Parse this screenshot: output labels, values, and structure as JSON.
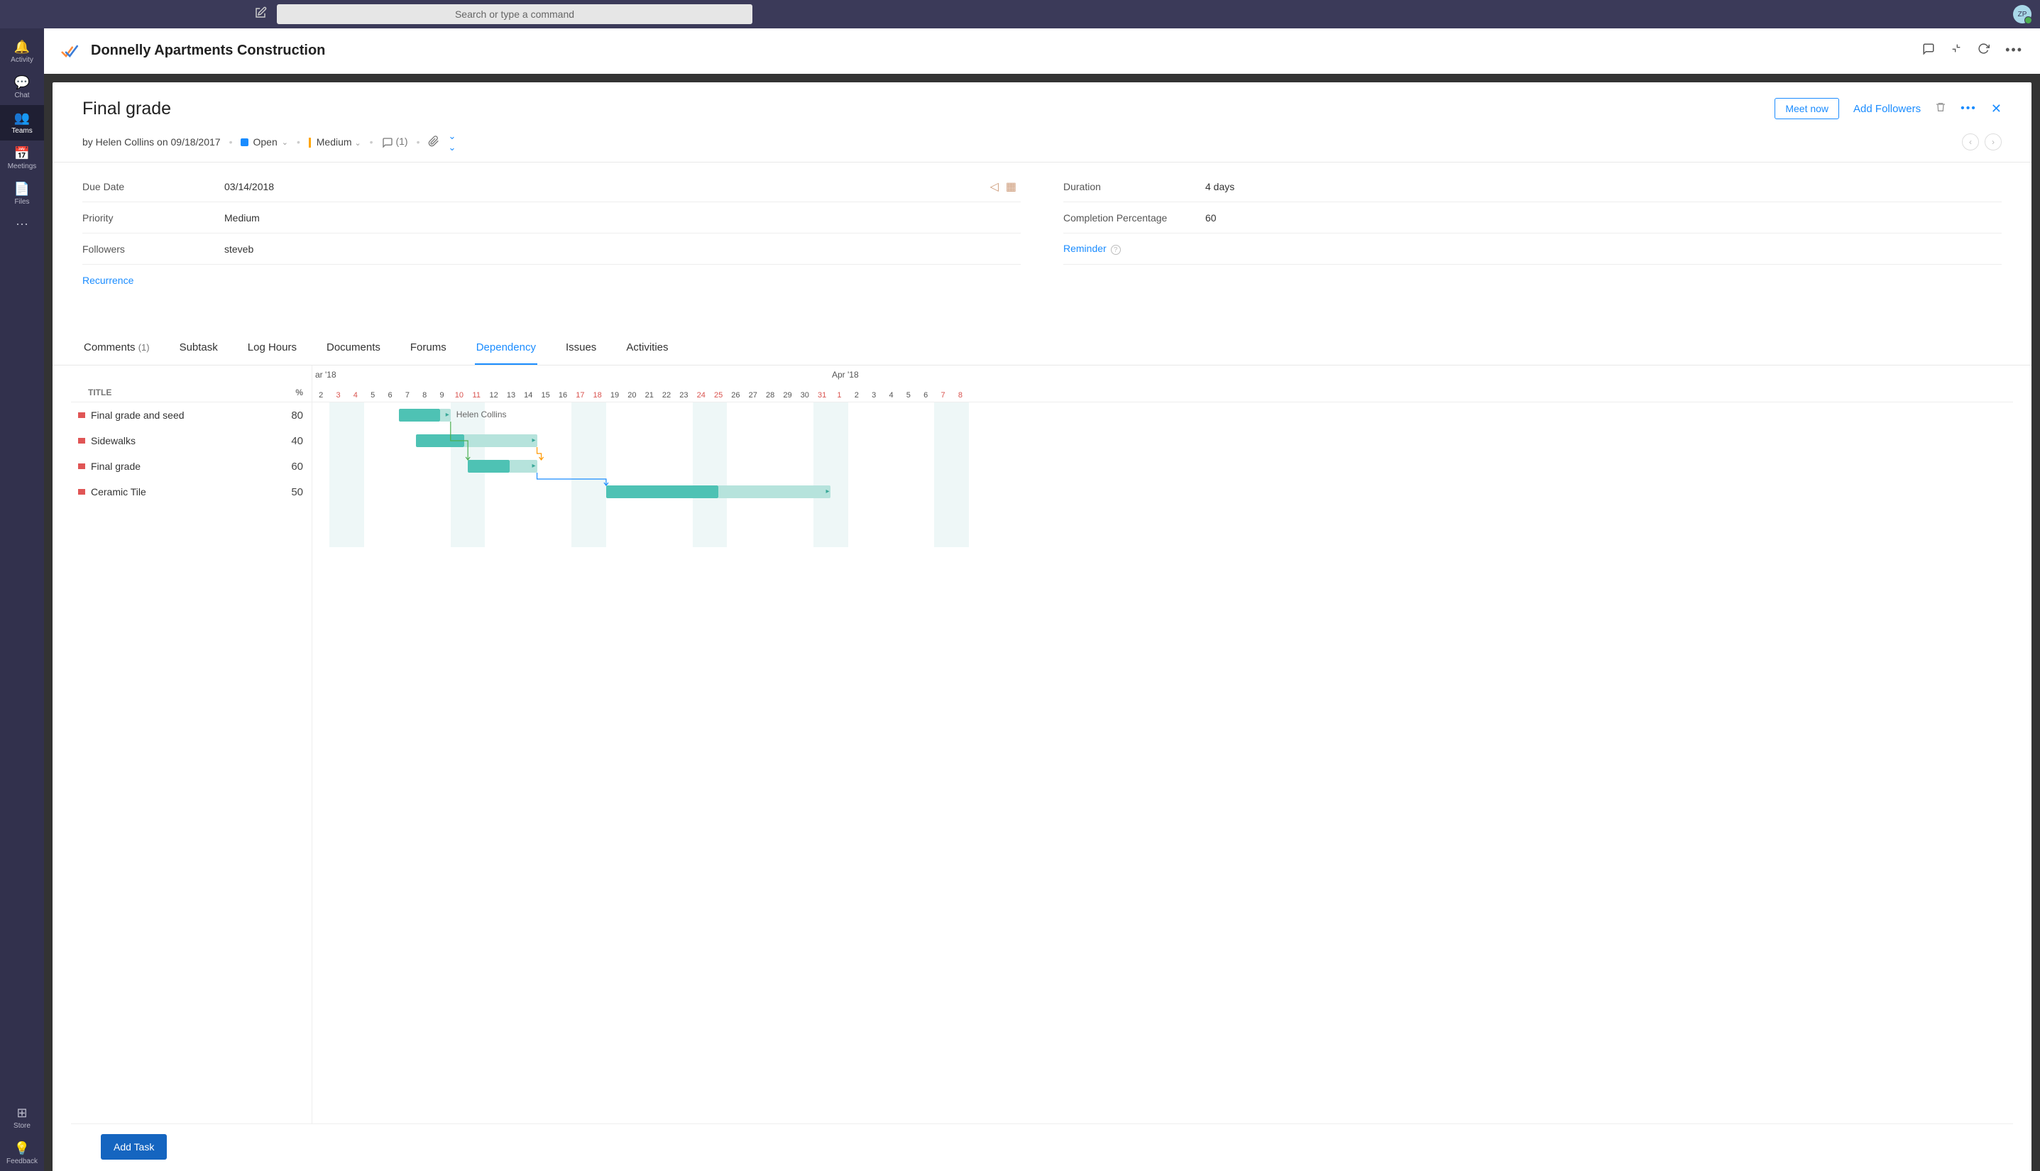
{
  "search": {
    "placeholder": "Search or type a command"
  },
  "avatar": {
    "initials": "ZP"
  },
  "siderail": [
    {
      "icon": "🔔",
      "label": "Activity"
    },
    {
      "icon": "💬",
      "label": "Chat"
    },
    {
      "icon": "👥",
      "label": "Teams",
      "active": true
    },
    {
      "icon": "📅",
      "label": "Meetings"
    },
    {
      "icon": "📄",
      "label": "Files"
    },
    {
      "icon": "⋯",
      "label": ""
    }
  ],
  "siderail_bottom": [
    {
      "icon": "⊞",
      "label": "Store"
    },
    {
      "icon": "💡",
      "label": "Feedback"
    }
  ],
  "page": {
    "title": "Donnelly Apartments Construction"
  },
  "task": {
    "title": "Final grade",
    "meet_now": "Meet now",
    "add_followers": "Add Followers",
    "author_line": "by Helen Collins on 09/18/2017",
    "status": "Open",
    "priority_chip": "Medium",
    "comments_count": "(1)",
    "fields": {
      "due_date": {
        "label": "Due Date",
        "value": "03/14/2018"
      },
      "duration": {
        "label": "Duration",
        "value": "4 days"
      },
      "priority": {
        "label": "Priority",
        "value": "Medium"
      },
      "completion": {
        "label": "Completion Percentage",
        "value": "60"
      },
      "followers": {
        "label": "Followers",
        "value": "steveb"
      },
      "reminder": {
        "label": "Reminder"
      },
      "recurrence": {
        "label": "Recurrence"
      }
    }
  },
  "tabs": [
    {
      "label": "Comments",
      "count": "(1)"
    },
    {
      "label": "Subtask"
    },
    {
      "label": "Log Hours"
    },
    {
      "label": "Documents"
    },
    {
      "label": "Forums"
    },
    {
      "label": "Dependency",
      "active": true
    },
    {
      "label": "Issues"
    },
    {
      "label": "Activities"
    }
  ],
  "gantt": {
    "col_title": "TITLE",
    "col_pct": "%",
    "month_left": "ar '18",
    "month_right": "Apr '18",
    "days": [
      {
        "n": "2"
      },
      {
        "n": "3",
        "w": true
      },
      {
        "n": "4",
        "w": true
      },
      {
        "n": "5"
      },
      {
        "n": "6"
      },
      {
        "n": "7"
      },
      {
        "n": "8"
      },
      {
        "n": "9"
      },
      {
        "n": "10",
        "w": true
      },
      {
        "n": "11",
        "w": true
      },
      {
        "n": "12"
      },
      {
        "n": "13"
      },
      {
        "n": "14"
      },
      {
        "n": "15"
      },
      {
        "n": "16"
      },
      {
        "n": "17",
        "w": true
      },
      {
        "n": "18",
        "w": true
      },
      {
        "n": "19"
      },
      {
        "n": "20"
      },
      {
        "n": "21"
      },
      {
        "n": "22"
      },
      {
        "n": "23"
      },
      {
        "n": "24",
        "w": true
      },
      {
        "n": "25",
        "w": true
      },
      {
        "n": "26"
      },
      {
        "n": "27"
      },
      {
        "n": "28"
      },
      {
        "n": "29"
      },
      {
        "n": "30"
      },
      {
        "n": "31",
        "w": true
      },
      {
        "n": "1",
        "w": true
      },
      {
        "n": "2"
      },
      {
        "n": "3"
      },
      {
        "n": "4"
      },
      {
        "n": "5"
      },
      {
        "n": "6"
      },
      {
        "n": "7",
        "w": true
      },
      {
        "n": "8",
        "w": true
      }
    ],
    "rows": [
      {
        "title": "Final grade and seed",
        "pct": "80",
        "start": 5,
        "len": 3,
        "fill": 0.8,
        "label": "Helen Collins"
      },
      {
        "title": "Sidewalks",
        "pct": "40",
        "start": 6,
        "len": 7,
        "fill": 0.4
      },
      {
        "title": "Final grade",
        "pct": "60",
        "start": 9,
        "len": 4,
        "fill": 0.6
      },
      {
        "title": "Ceramic Tile",
        "pct": "50",
        "start": 17,
        "len": 13,
        "fill": 0.5
      }
    ]
  },
  "add_task": "Add Task"
}
